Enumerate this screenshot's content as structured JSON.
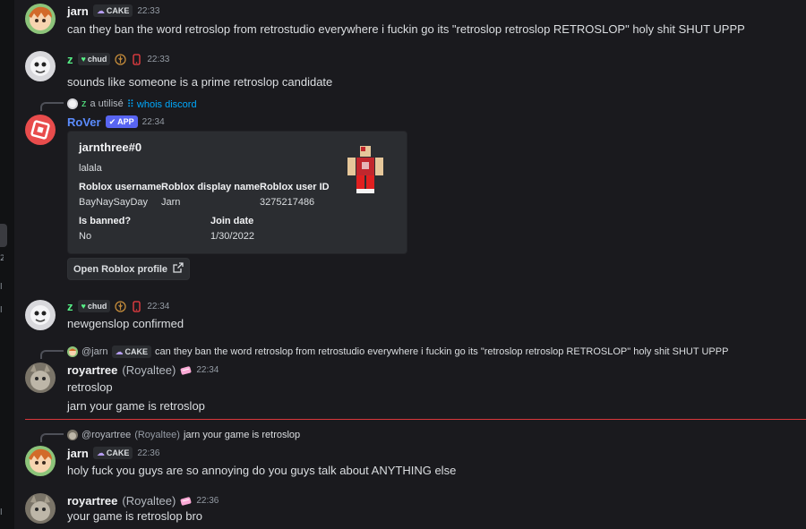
{
  "messages": [
    {
      "author": "jarn",
      "tag": "CAKE",
      "time": "22:33",
      "text": "can they ban the word retroslop from retrostudio everywhere i fuckin go its \"retroslop retroslop RETROSLOP\" holy shit SHUT UPPP"
    },
    {
      "author": "z",
      "tag": "chud",
      "time": "22:33",
      "text": "sounds like someone is a prime retroslop candidate"
    },
    {
      "reply": {
        "user": "z",
        "action": "a utilisé",
        "command": "whois discord"
      },
      "author": "RoVer",
      "app_label": "APP",
      "time": "22:34",
      "embed": {
        "title": "jarnthree#0",
        "description": "lalala",
        "fields": [
          {
            "name": "Roblox username",
            "value": "BayNaySayDay"
          },
          {
            "name": "Roblox display name",
            "value": "Jarn"
          },
          {
            "name": "Roblox user ID",
            "value": "3275217486"
          },
          {
            "name": "Is banned?",
            "value": "No"
          },
          {
            "name": "Join date",
            "value": "1/30/2022"
          }
        ]
      },
      "button_label": "Open Roblox profile"
    },
    {
      "author": "z",
      "tag": "chud",
      "time": "22:34",
      "text": "newgenslop confirmed"
    },
    {
      "reply": {
        "user": "@jarn",
        "tag": "CAKE",
        "text": "can they ban the word retroslop from retrostudio everywhere i fuckin go its \"retroslop retroslop RETROSLOP\" holy shit SHUT UPPP"
      },
      "author": "royartree",
      "display": "(Royaltee)",
      "time": "22:34",
      "lines": [
        "retroslop",
        "jarn your game is retroslop"
      ]
    },
    {
      "reply": {
        "user": "@royartree",
        "display": "(Royaltee)",
        "text": "jarn your game is retroslop"
      },
      "author": "jarn",
      "tag": "CAKE",
      "time": "22:36",
      "text": "holy fuck you guys are so annoying do you guys talk about ANYTHING else"
    },
    {
      "author": "royartree",
      "display": "(Royaltee)",
      "time": "22:36",
      "text": "your game is retroslop bro"
    }
  ],
  "left_strip_marks": [
    "2",
    "l",
    "l",
    "l"
  ],
  "colors": {
    "background": "#1a1a1e",
    "unread_divider": "#da373c",
    "app_badge": "#5865f2",
    "link": "#00a8fc",
    "chud_name": "#57f287",
    "rover_name": "#5b8cff"
  },
  "icons": {
    "cake": "cake-icon",
    "heart": "green-heart-icon",
    "wheat": "wheat-badge-icon",
    "phone": "mobile-phone-icon",
    "external": "external-link-icon",
    "tiara": "pink-tiara-icon",
    "slash": "slash-command-icon",
    "check": "checkmark-icon"
  }
}
